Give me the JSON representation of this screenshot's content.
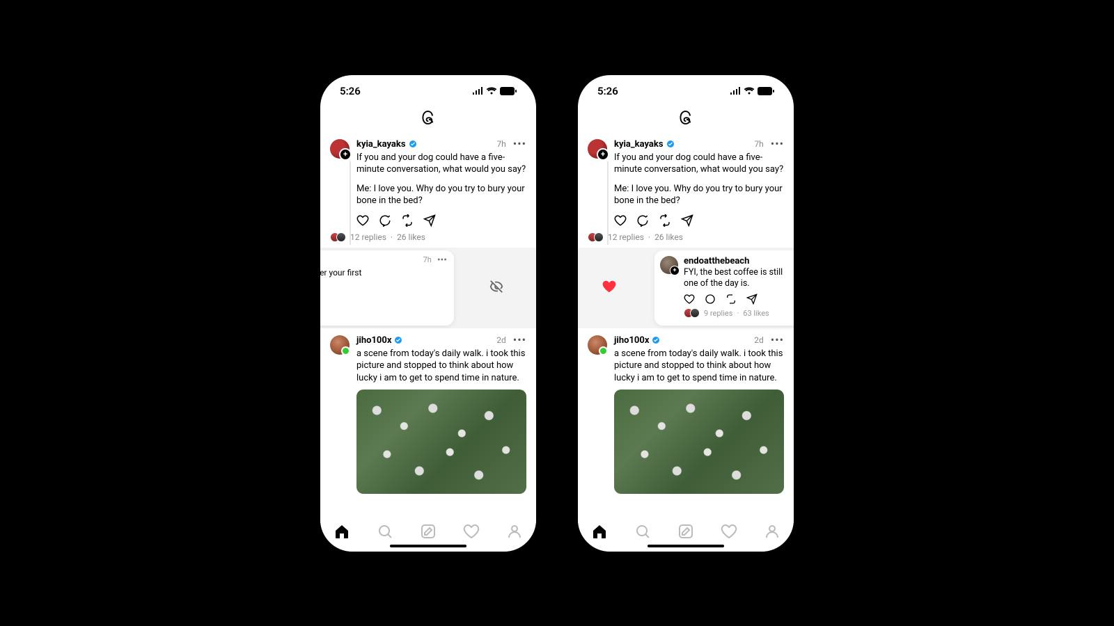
{
  "statusbar": {
    "time": "5:26"
  },
  "post1": {
    "username": "kyia_kayaks",
    "time": "7h",
    "line1": "If you and your dog could have a five-minute conversation, what would you say?",
    "line2": "Me: I love you. Why do you try to bury your bone in the bed?",
    "replies": "12 replies",
    "sep": "·",
    "likes": "26 likes"
  },
  "swipe": {
    "user_fragment": "ach",
    "time": "7h",
    "text_fragment": "coffee is still whatever your first",
    "text_fragment2": "y is.",
    "likes_fragment": "63 likes"
  },
  "reply": {
    "username": "endoatthebeach",
    "text": "FYI, the best coffee is still one of the day is.",
    "replies": "9 replies",
    "sep": "·",
    "likes": "63 likes"
  },
  "post2": {
    "username": "jiho100x",
    "time": "2d",
    "text": "a scene from today's daily walk. i took this picture and stopped to think about how lucky i am to get to spend time in nature."
  }
}
